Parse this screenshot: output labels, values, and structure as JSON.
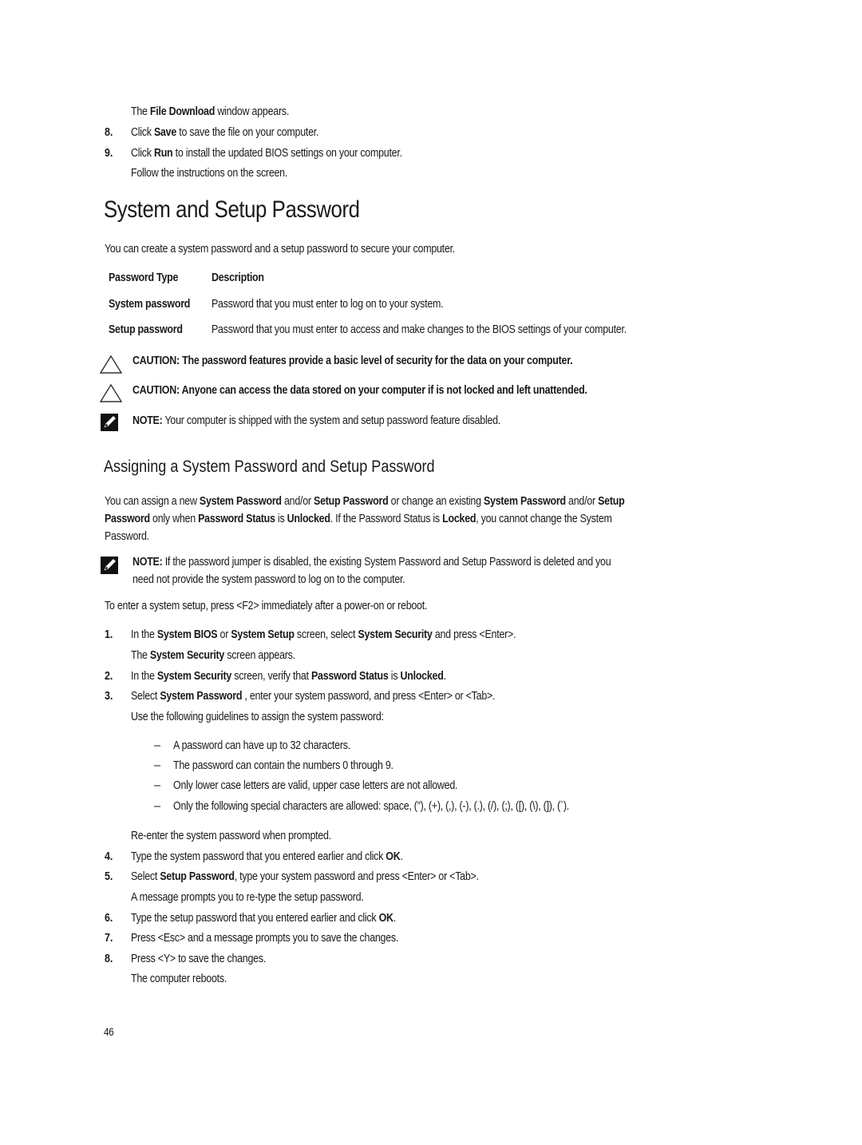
{
  "intro_steps": {
    "line0": {
      "pre": "The ",
      "bold": "File Download",
      "post": " window appears."
    },
    "step8": {
      "num": "8.",
      "pre": "Click ",
      "bold": "Save",
      "post": " to save the file on your computer."
    },
    "step9": {
      "num": "9.",
      "pre": "Click ",
      "bold": "Run",
      "post": " to install the updated BIOS settings on your computer."
    },
    "line_follow": "Follow the instructions on the screen."
  },
  "section_title": "System and Setup Password",
  "section_intro": "You can create a system password and a setup password to secure your computer.",
  "table": {
    "headers": [
      "Password Type",
      "Description"
    ],
    "rows": [
      {
        "type": "System password",
        "desc": "Password that you must enter to log on to your system."
      },
      {
        "type": "Setup password",
        "desc": "Password that you must enter to access and make changes to the BIOS settings of your computer."
      }
    ]
  },
  "cautions": [
    "CAUTION: The password features provide a basic level of security for the data on your computer.",
    "CAUTION: Anyone can access the data stored on your computer if is not locked and left unattended."
  ],
  "note1": {
    "label": "NOTE:",
    "text": " Your computer is shipped with the system and setup password feature disabled."
  },
  "subsection_title": "Assigning a System Password and Setup Password",
  "assign_para": {
    "l1": [
      "You can assign a new ",
      "System Password",
      " and/or ",
      "Setup Password",
      " or change an existing ",
      "System Password",
      " and/or ",
      "Setup"
    ],
    "l2": [
      "Password",
      " only when ",
      "Password Status",
      " is ",
      "Unlocked",
      ". If the Password Status is ",
      "Locked",
      ", you cannot change the System"
    ],
    "l3": "Password."
  },
  "note2": {
    "label": "NOTE:",
    "l1": " If the password jumper is disabled, the existing System Password and Setup Password is deleted and you",
    "l2": "need not provide the system password to log on to the computer."
  },
  "enter_setup": "To enter a system setup, press <F2> immediately after a power-on or reboot.",
  "steps": {
    "s1": {
      "num": "1.",
      "parts": [
        "In the ",
        "System BIOS",
        " or ",
        "System Setup",
        " screen, select ",
        "System Security",
        " and press <Enter>."
      ],
      "sub": [
        "The ",
        "System Security",
        " screen appears."
      ]
    },
    "s2": {
      "num": "2.",
      "parts": [
        "In the ",
        "System Security",
        " screen, verify that ",
        "Password Status",
        " is ",
        "Unlocked",
        "."
      ]
    },
    "s3": {
      "num": "3.",
      "parts": [
        "Select ",
        "System Password",
        " , enter your system password, and press <Enter> or <Tab>."
      ],
      "sub": "Use the following guidelines to assign the system password:"
    },
    "guidelines": [
      "A password can have up to 32 characters.",
      "The password can contain the numbers 0 through 9.",
      "Only lower case letters are valid, upper case letters are not allowed.",
      "Only the following special characters are allowed: space, (”), (+), (,), (-), (.), (/), (;), ([), (\\), (]), (`)."
    ],
    "reenter": "Re-enter the system password when prompted.",
    "s4": {
      "num": "4.",
      "parts": [
        "Type the system password that you entered earlier and click ",
        "OK",
        "."
      ]
    },
    "s5": {
      "num": "5.",
      "parts": [
        "Select ",
        "Setup Password",
        ", type your system password and press <Enter> or <Tab>."
      ],
      "sub": "A message prompts you to re-type the setup password."
    },
    "s6": {
      "num": "6.",
      "parts": [
        "Type the setup password that you entered earlier and click ",
        "OK",
        "."
      ]
    },
    "s7": {
      "num": "7.",
      "text": "Press <Esc> and a message prompts you to save the changes."
    },
    "s8": {
      "num": "8.",
      "text": "Press <Y> to save the changes.",
      "sub": "The computer reboots."
    }
  },
  "page_number": "46",
  "icons": {
    "caution": "warning-triangle-icon",
    "note": "pencil-note-icon"
  }
}
